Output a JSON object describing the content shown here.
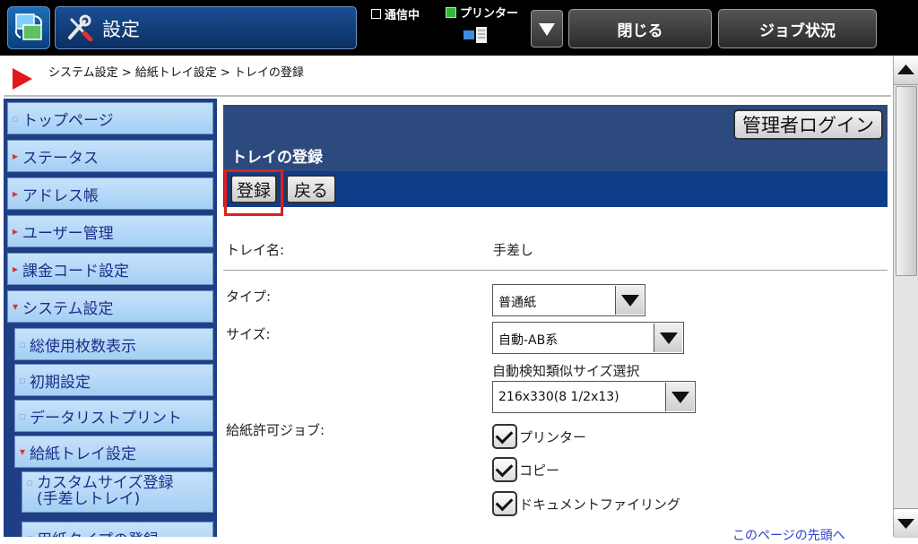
{
  "header": {
    "title": "設定",
    "status_comm": "通信中",
    "status_printer": "プリンター",
    "close_label": "閉じる",
    "job_status_label": "ジョブ状況"
  },
  "breadcrumb": {
    "text": "システム設定 > 給紙トレイ設定 > トレイの登録"
  },
  "sidebar": {
    "items": [
      {
        "label": "トップページ"
      },
      {
        "label": "ステータス"
      },
      {
        "label": "アドレス帳"
      },
      {
        "label": "ユーザー管理"
      },
      {
        "label": "課金コード設定"
      },
      {
        "label": "システム設定"
      },
      {
        "label": "総使用枚数表示"
      },
      {
        "label": "初期設定"
      },
      {
        "label": "データリストプリント"
      },
      {
        "label": "給紙トレイ設定"
      },
      {
        "label": "カスタムサイズ登録",
        "label2": "(手差しトレイ)"
      },
      {
        "label": "用紙タイプの登録"
      }
    ]
  },
  "content": {
    "admin_login": "管理者ログイン",
    "title": "トレイの登録",
    "register_label": "登録",
    "back_label": "戻る",
    "tray_name_label": "トレイ名:",
    "tray_name_value": "手差し",
    "type_label": "タイプ:",
    "type_value": "普通紙",
    "size_label": "サイズ:",
    "size_value": "自動-AB系",
    "similar_size_caption": "自動検知類似サイズ選択",
    "similar_size_value": "216x330(8 1/2x13)",
    "allowed_jobs_label": "給紙許可ジョブ:",
    "jobs": [
      {
        "label": "プリンター",
        "checked": true
      },
      {
        "label": "コピー",
        "checked": true
      },
      {
        "label": "ドキュメントファイリング",
        "checked": true
      }
    ],
    "page_top_link": "このページの先頭へ"
  },
  "colors": {
    "sidebar_bg": "#1e3f86",
    "sidebar_item": "#b3d7f7",
    "content_header": "#2c4a7e",
    "action_bar": "#0f3d8a",
    "highlight": "#e0201e"
  }
}
